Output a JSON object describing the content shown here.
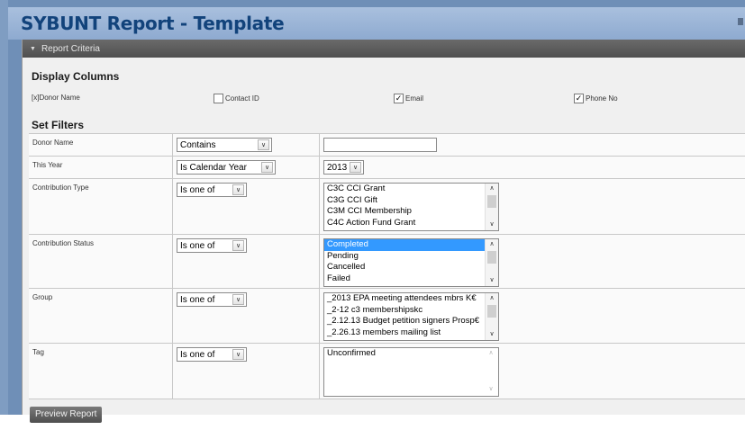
{
  "header": {
    "title": "SYBUNT Report - Template"
  },
  "panel": {
    "title": "Report Criteria"
  },
  "display_columns": {
    "title": "Display Columns",
    "columns": [
      {
        "label": "Donor Name",
        "marker": "[x]",
        "checked": true
      },
      {
        "label": "Contact ID",
        "checked": false
      },
      {
        "label": "Email",
        "checked": true
      },
      {
        "label": "Phone No",
        "checked": true
      }
    ]
  },
  "filters": {
    "title": "Set Filters",
    "rows": [
      {
        "label": "Donor Name",
        "operator": "Contains",
        "value": ""
      },
      {
        "label": "This Year",
        "operator": "Is Calendar Year",
        "value": "2013"
      },
      {
        "label": "Contribution Type",
        "operator": "Is one of",
        "options": [
          "C3C CCI Grant",
          "C3G CCI Gift",
          "C3M CCI Membership",
          "C4C Action Fund Grant"
        ]
      },
      {
        "label": "Contribution Status",
        "operator": "Is one of",
        "options": [
          "Completed",
          "Pending",
          "Cancelled",
          "Failed"
        ],
        "selected": "Completed"
      },
      {
        "label": "Group",
        "operator": "Is one of",
        "options": [
          "_2013 EPA meeting attendees mbrs K€",
          "_2-12 c3 membershipskc",
          "_2.12.13 Budget petition signers Prosp€",
          "_2.26.13 members mailing list"
        ]
      },
      {
        "label": "Tag",
        "operator": "Is one of",
        "options": [
          "Unconfirmed"
        ]
      }
    ]
  },
  "actions": {
    "preview_label": "Preview Report"
  },
  "glyphs": {
    "dropdown": "∨",
    "up": "∧",
    "down": "∨",
    "collapse": "▼",
    "check": "✓"
  },
  "colors": {
    "title": "#12437b",
    "selection": "#3399ff",
    "header_bg": "#9bb5d8"
  }
}
